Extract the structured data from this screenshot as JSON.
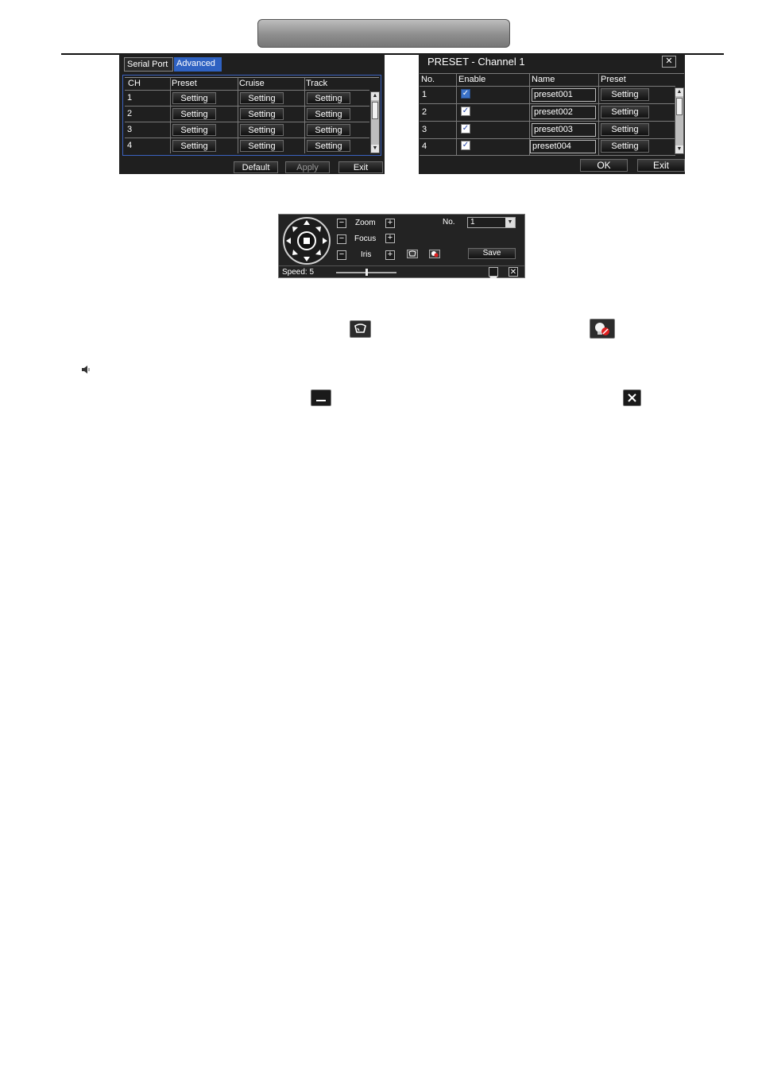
{
  "advanced_panel": {
    "tabs": [
      {
        "label": "Serial Port"
      },
      {
        "label": "Advanced"
      }
    ],
    "columns": [
      "CH",
      "Preset",
      "Cruise",
      "Track"
    ],
    "rows": [
      {
        "ch": "1",
        "preset": "Setting",
        "cruise": "Setting",
        "track": "Setting"
      },
      {
        "ch": "2",
        "preset": "Setting",
        "cruise": "Setting",
        "track": "Setting"
      },
      {
        "ch": "3",
        "preset": "Setting",
        "cruise": "Setting",
        "track": "Setting"
      },
      {
        "ch": "4",
        "preset": "Setting",
        "cruise": "Setting",
        "track": "Setting"
      }
    ],
    "buttons": {
      "default": "Default",
      "apply": "Apply",
      "exit": "Exit"
    }
  },
  "preset_dialog": {
    "title": "PRESET - Channel 1",
    "close": "✕",
    "columns": [
      "No.",
      "Enable",
      "Name",
      "Preset"
    ],
    "rows": [
      {
        "no": "1",
        "enabled": true,
        "name": "preset001",
        "preset": "Setting"
      },
      {
        "no": "2",
        "enabled": true,
        "name": "preset002",
        "preset": "Setting"
      },
      {
        "no": "3",
        "enabled": true,
        "name": "preset003",
        "preset": "Setting"
      },
      {
        "no": "4",
        "enabled": true,
        "name": "preset004",
        "preset": "Setting"
      }
    ],
    "buttons": {
      "ok": "OK",
      "exit": "Exit"
    }
  },
  "ptz_panel": {
    "zoom_label": "Zoom",
    "focus_label": "Focus",
    "iris_label": "Iris",
    "minus": "−",
    "plus": "+",
    "no_label": "No.",
    "no_value": "1",
    "save_label": "Save",
    "speed_label": "Speed: 5",
    "speed_value": 5,
    "speed_max": 10
  },
  "inline_icons": [
    "wiper-icon",
    "light-icon",
    "speaker-icon",
    "minimize-icon",
    "close-icon"
  ]
}
